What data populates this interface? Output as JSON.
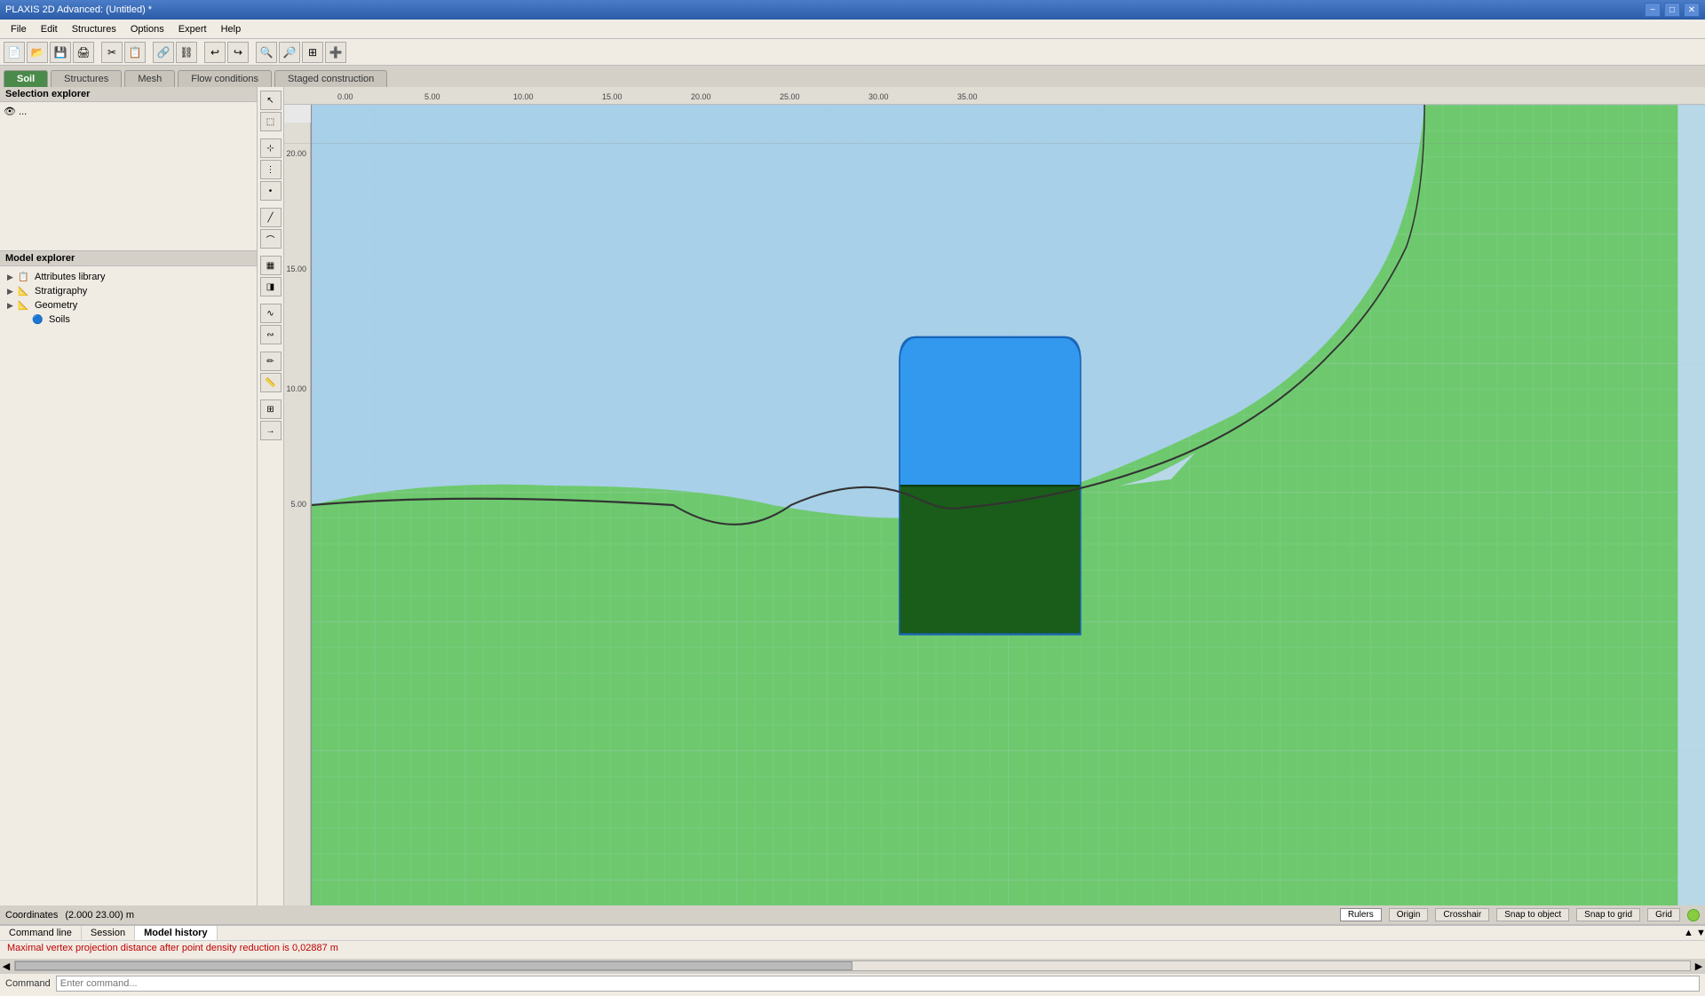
{
  "titlebar": {
    "title": "PLAXIS 2D Advanced: (Untitled) *",
    "min": "−",
    "max": "□",
    "close": "✕"
  },
  "menubar": {
    "items": [
      "File",
      "Edit",
      "Structures",
      "Options",
      "Expert",
      "Help"
    ]
  },
  "toolbar": {
    "buttons": [
      "📄",
      "💾",
      "🖨",
      "✂",
      "📋",
      "🔗",
      "↩",
      "↪",
      "🔍",
      "🔎",
      "➕"
    ]
  },
  "tabs": [
    {
      "label": "Soil",
      "active": true
    },
    {
      "label": "Structures",
      "active": false
    },
    {
      "label": "Mesh",
      "active": false
    },
    {
      "label": "Flow conditions",
      "active": false
    },
    {
      "label": "Staged construction",
      "active": false
    }
  ],
  "selection_explorer": {
    "title": "Selection explorer",
    "eye_label": "👁 ..."
  },
  "model_explorer": {
    "title": "Model explorer",
    "items": [
      {
        "label": "Attributes library",
        "indent": 0,
        "expandable": true,
        "icon": "📋"
      },
      {
        "label": "Stratigraphy",
        "indent": 0,
        "expandable": true,
        "icon": "📐"
      },
      {
        "label": "Geometry",
        "indent": 0,
        "expandable": true,
        "icon": "📐"
      },
      {
        "label": "Soils",
        "indent": 1,
        "expandable": false,
        "icon": "🔵"
      }
    ]
  },
  "ruler": {
    "x_marks": [
      "0.00",
      "5.00",
      "10.00",
      "15.00",
      "20.00",
      "25.00",
      "30.00",
      "35.00"
    ],
    "y_marks": [
      "20.00",
      "15.00",
      "10.00",
      "5.00"
    ]
  },
  "status_bar": {
    "coordinates": "Coordinates",
    "coords_value": "(2.000 23.00) m",
    "buttons": [
      "Rulers",
      "Origin",
      "Crosshair",
      "Snap to object",
      "Snap to grid",
      "Grid"
    ]
  },
  "command_area": {
    "tabs": [
      "Command line",
      "Session",
      "Model history"
    ],
    "active_tab": "Model history",
    "output": "Maximal vertex projection distance after point density reduction is 0,02887 m",
    "input_label": "Command"
  },
  "colors": {
    "sky_blue": "#a8d4e8",
    "water_blue": "#4488cc",
    "ground_green": "#6ec96e",
    "dark_green": "#1a5c1a",
    "structure_blue": "#3399ee",
    "grid_line": "#c8e0f0"
  }
}
